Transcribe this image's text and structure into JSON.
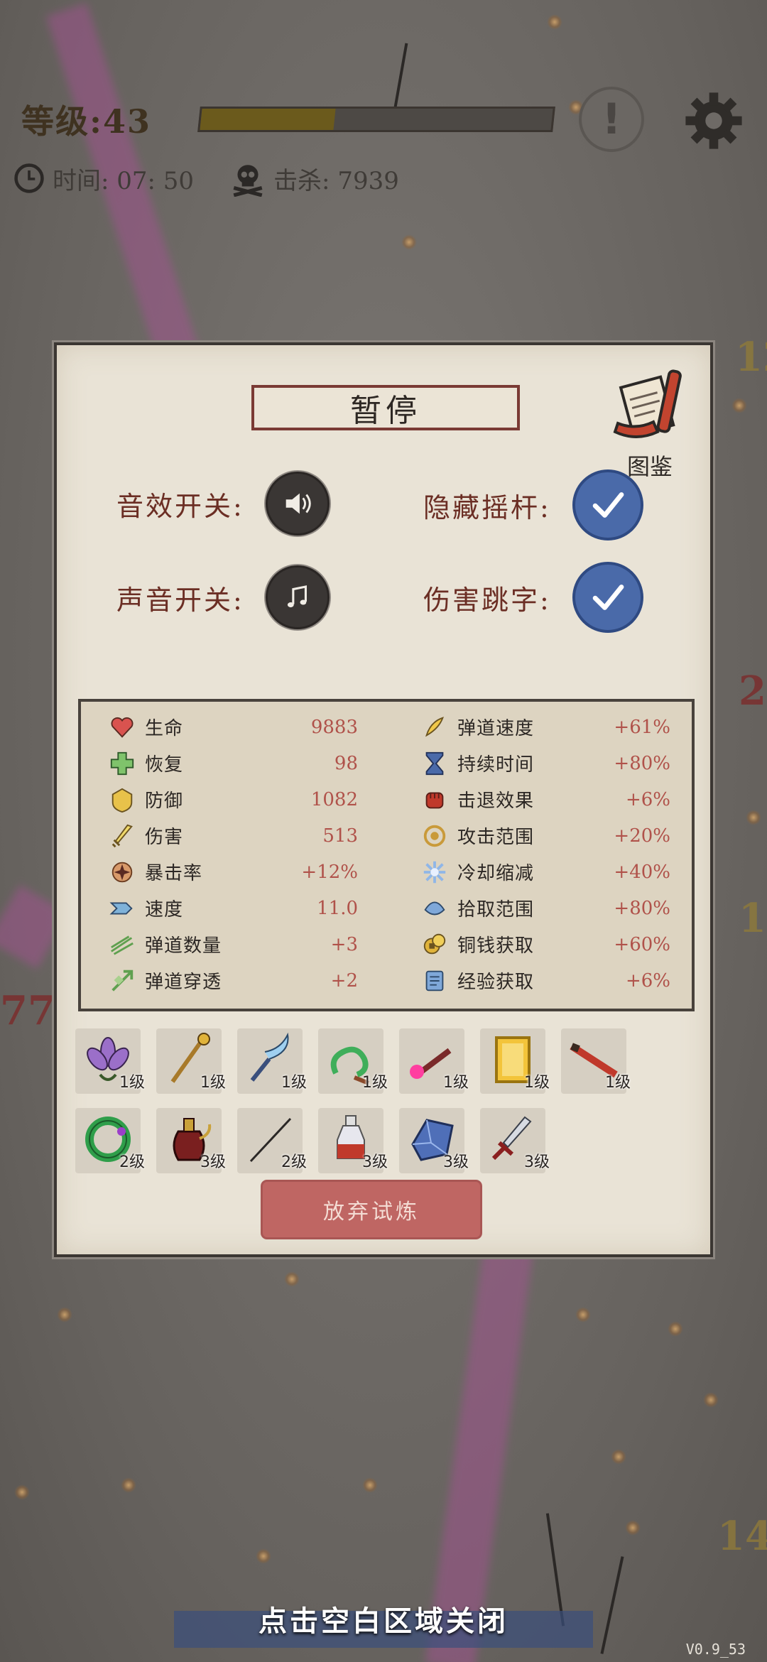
{
  "hud": {
    "level_label": "等级:43",
    "level_progress": 0.38,
    "time_label": "时间: 07: 50",
    "kills_label": "击杀: 7939"
  },
  "panel": {
    "title": "暂停",
    "codex_label": "图鉴",
    "settings": {
      "sfx_label": "音效开关:",
      "hide_joystick_label": "隐藏摇杆:",
      "sound_label": "声音开关:",
      "damage_numbers_label": "伤害跳字:",
      "hide_joystick_checked": true,
      "damage_numbers_checked": true
    },
    "stats_left": [
      {
        "name": "生命",
        "value": "9883",
        "icon": "heart-icon"
      },
      {
        "name": "恢复",
        "value": "98",
        "icon": "regen-cross-icon"
      },
      {
        "name": "防御",
        "value": "1082",
        "icon": "armor-icon"
      },
      {
        "name": "伤害",
        "value": "513",
        "icon": "sword-icon"
      },
      {
        "name": "暴击率",
        "value": "+12%",
        "icon": "crit-icon"
      },
      {
        "name": "速度",
        "value": "11.0",
        "icon": "speed-icon"
      },
      {
        "name": "弹道数量",
        "value": "+3",
        "icon": "projectile-count-icon"
      },
      {
        "name": "弹道穿透",
        "value": "+2",
        "icon": "pierce-icon"
      }
    ],
    "stats_right": [
      {
        "name": "弹道速度",
        "value": "+61%",
        "icon": "projectile-speed-icon"
      },
      {
        "name": "持续时间",
        "value": "+80%",
        "icon": "hourglass-icon"
      },
      {
        "name": "击退效果",
        "value": "+6%",
        "icon": "fist-icon"
      },
      {
        "name": "攻击范围",
        "value": "+20%",
        "icon": "range-icon"
      },
      {
        "name": "冷却缩减",
        "value": "+40%",
        "icon": "snowflake-icon"
      },
      {
        "name": "拾取范围",
        "value": "+80%",
        "icon": "pickup-icon"
      },
      {
        "name": "铜钱获取",
        "value": "+60%",
        "icon": "coin-icon"
      },
      {
        "name": "经验获取",
        "value": "+6%",
        "icon": "scroll-icon"
      }
    ],
    "items_row1": [
      {
        "icon": "lotus-icon",
        "level": "1级"
      },
      {
        "icon": "staff-icon",
        "level": "1级"
      },
      {
        "icon": "sickle-icon",
        "level": "1级"
      },
      {
        "icon": "jade-dragon-icon",
        "level": "1级"
      },
      {
        "icon": "flute-fire-icon",
        "level": "1级"
      },
      {
        "icon": "golden-scroll-icon",
        "level": "1级"
      },
      {
        "icon": "red-flute-icon",
        "level": "1级"
      }
    ],
    "items_row2": [
      {
        "icon": "jade-ring-icon",
        "level": "2级"
      },
      {
        "icon": "wine-pot-icon",
        "level": "3级"
      },
      {
        "icon": "needle-icon",
        "level": "2级"
      },
      {
        "icon": "potion-icon",
        "level": "3级"
      },
      {
        "icon": "crystal-icon",
        "level": "3级"
      },
      {
        "icon": "dagger-icon",
        "level": "3级"
      }
    ],
    "quit_label": "放弃试炼"
  },
  "footer": {
    "close_hint": "点击空白区域关闭",
    "version": "V0.9_53"
  },
  "colors": {
    "panel_bg": "#e9e3d6",
    "label_red": "#6b2e24",
    "value_red": "#b0524a",
    "check_blue": "#4a6aa9",
    "quit_btn": "#bf6663"
  }
}
